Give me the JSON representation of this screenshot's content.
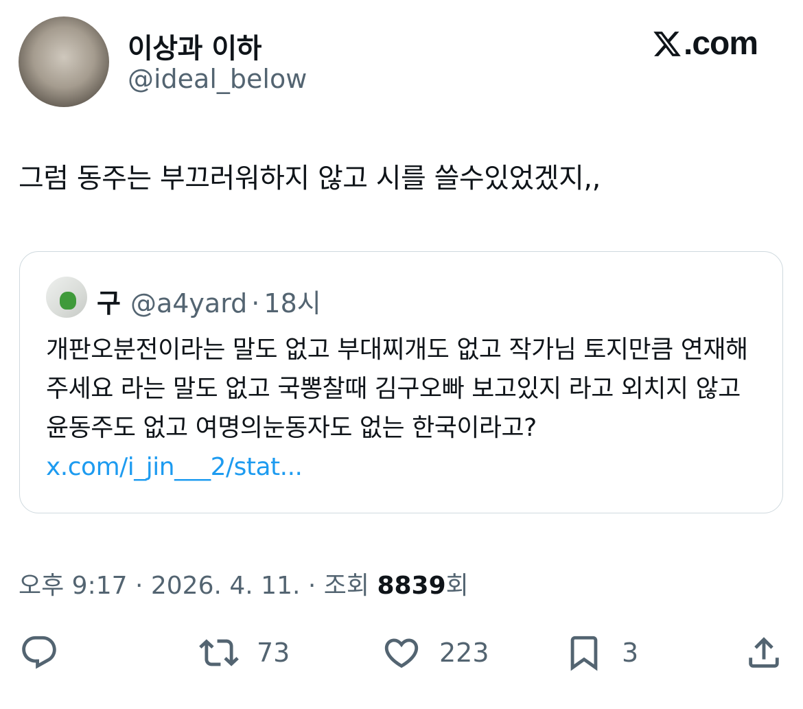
{
  "author": {
    "name": "이상과 이하",
    "handle": "@ideal_below"
  },
  "brand": {
    "logo_text": ".com"
  },
  "tweet": {
    "text": "그럼 동주는 부끄러워하지 않고 시를 쓸수있었겠지,,"
  },
  "quote": {
    "name": "구",
    "handle": "@a4yard",
    "separator": "·",
    "time": "18시",
    "text": "개판오분전이라는 말도 없고 부대찌개도 없고 작가님 토지만큼 연재해주세요 라는 말도 없고 국뽕찰때 김구오빠 보고있지 라고 외치지 않고 윤동주도 없고 여명의눈동자도 없는 한국이라고? ",
    "link": "x.com/i_jin___2/stat..."
  },
  "meta": {
    "time": "오후 9:17",
    "sep1": " · ",
    "date": "2026. 4. 11.",
    "sep2": " · ",
    "views_label": "조회 ",
    "views_count": "8839",
    "views_suffix": "회"
  },
  "actions": {
    "reply": {
      "icon": "reply-icon",
      "count": ""
    },
    "retweet": {
      "icon": "retweet-icon",
      "count": "73"
    },
    "like": {
      "icon": "heart-icon",
      "count": "223"
    },
    "bookmark": {
      "icon": "bookmark-icon",
      "count": "3"
    },
    "share": {
      "icon": "share-icon",
      "count": ""
    }
  },
  "colors": {
    "text_primary": "#0f1419",
    "text_secondary": "#536471",
    "link": "#1d9bf0",
    "border": "#cfd9de"
  }
}
